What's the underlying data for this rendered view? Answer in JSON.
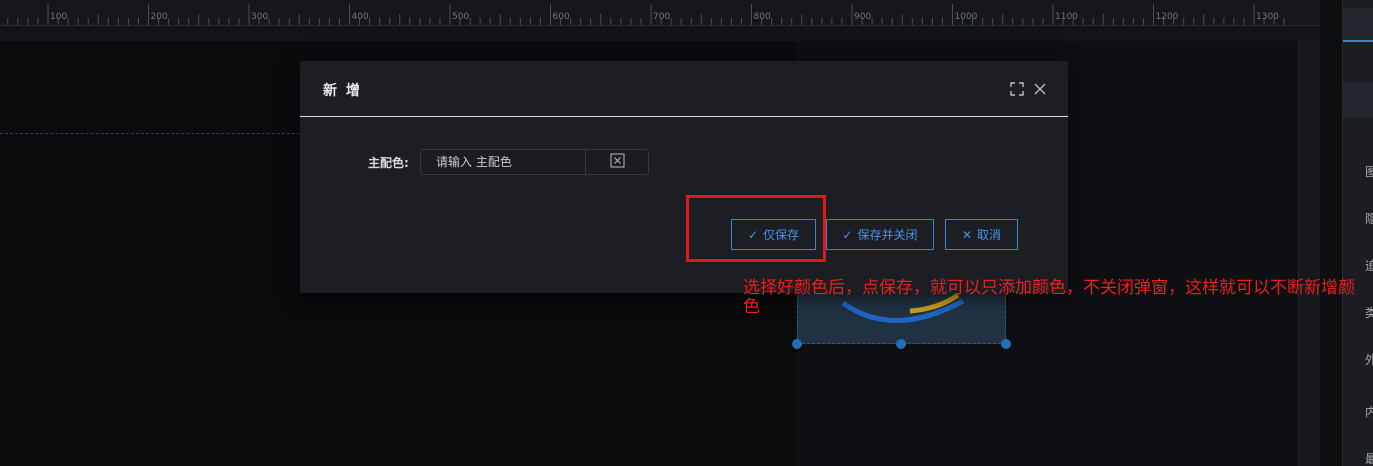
{
  "ruler": {
    "marks": [
      "100",
      "200",
      "300",
      "400",
      "500",
      "600",
      "700",
      "800",
      "900",
      "1000",
      "1100",
      "1200",
      "1300"
    ]
  },
  "right_panel": {
    "labels": [
      "图",
      "隐",
      "追",
      "类",
      "外",
      "内",
      "最"
    ]
  },
  "dialog": {
    "title": "新 增",
    "fullscreen_icon": "fullscreen-icon",
    "close_icon": "close-icon",
    "field_label": "主配色:",
    "field_placeholder": "请输入 主配色",
    "clear_icon": "clear-box-icon",
    "buttons": {
      "save_only": "仅保存",
      "save_close": "保存并关闭",
      "cancel": "取消"
    }
  },
  "annotation": "选择好颜色后，点保存，就可以只添加颜色，不关闭弹窗，这样就可以不断新增颜色",
  "colors": {
    "accent": "#3b82d6",
    "highlight": "#e0181b",
    "background": "#0b0b0d",
    "dialog": "#1c1e24"
  }
}
